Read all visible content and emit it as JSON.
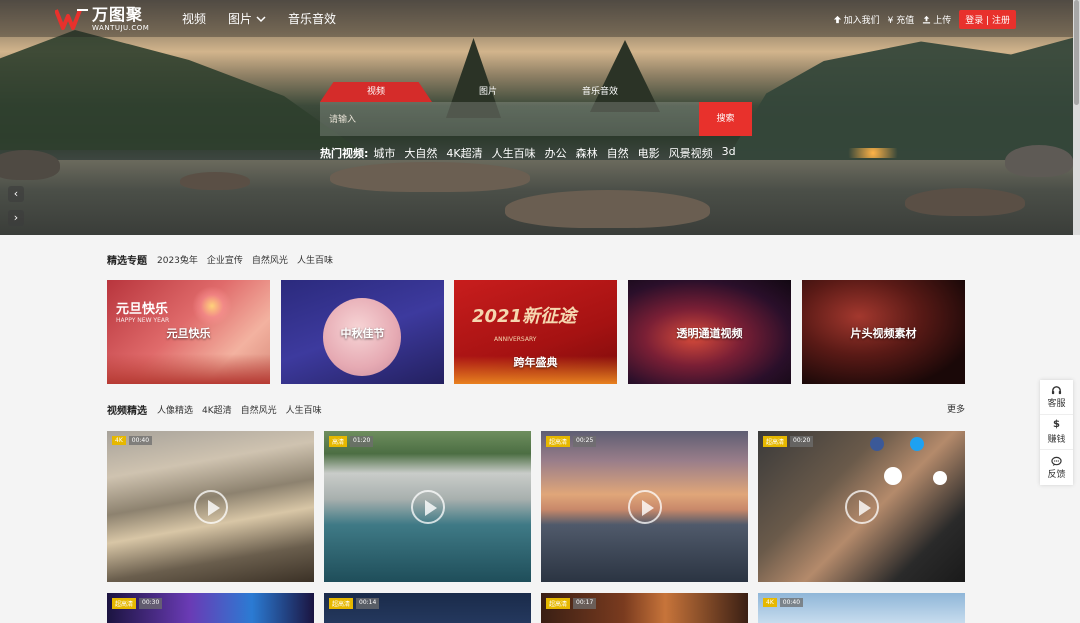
{
  "header": {
    "logo_cn": "万图聚",
    "logo_en": "WANTUJU.COM",
    "nav": [
      {
        "label": "视频"
      },
      {
        "label": "图片"
      },
      {
        "label": "音乐音效"
      }
    ],
    "join_label": "加入我们",
    "recharge_label": "¥ 充值",
    "upload_label": "上传",
    "login_label": "登录 | 注册"
  },
  "search": {
    "tabs": [
      "视频",
      "图片",
      "音乐音效"
    ],
    "placeholder": "请输入",
    "button_label": "搜索",
    "hot_label": "热门视频:",
    "hot_items": [
      "城市",
      "大自然",
      "4K超清",
      "人生百味",
      "办公",
      "森林",
      "自然",
      "电影",
      "风景视频",
      "3d"
    ]
  },
  "carousel": {
    "prev": "‹",
    "next": "›"
  },
  "featured": {
    "title": "精选专题",
    "tags": [
      "2023兔年",
      "企业宣传",
      "自然风光",
      "人生百味"
    ],
    "topics": [
      {
        "label": "元旦快乐",
        "deco": "元旦快乐",
        "sub": "HAPPY NEW YEAR"
      },
      {
        "label": "中秋佳节"
      },
      {
        "label": "跨年盛典",
        "deco": "2021新征途",
        "sub": "ANNIVERSARY"
      },
      {
        "label": "透明通道视频"
      },
      {
        "label": "片头视频素材"
      }
    ]
  },
  "videos": {
    "title": "视频精选",
    "tags": [
      "人像精选",
      "4K超清",
      "自然风光",
      "人生百味"
    ],
    "more_label": "更多",
    "cards": [
      {
        "tag": "4K",
        "duration": "00:40"
      },
      {
        "tag": "高清",
        "duration": "01:20"
      },
      {
        "tag": "超高清",
        "duration": "00:25"
      },
      {
        "tag": "超高清",
        "duration": "00:20"
      },
      {
        "tag": "超高清",
        "duration": "00:30"
      },
      {
        "tag": "超高清",
        "duration": "00:14"
      },
      {
        "tag": "超高清",
        "duration": "00:17"
      },
      {
        "tag": "4K",
        "duration": "00:40"
      }
    ]
  },
  "side_tools": [
    {
      "icon": "headset-icon",
      "label": "客服"
    },
    {
      "icon": "dollar-icon",
      "label": "赚钱"
    },
    {
      "icon": "chat-icon",
      "label": "反馈"
    }
  ],
  "colors": {
    "accent": "#e8312c",
    "badge": "#e6b800"
  }
}
